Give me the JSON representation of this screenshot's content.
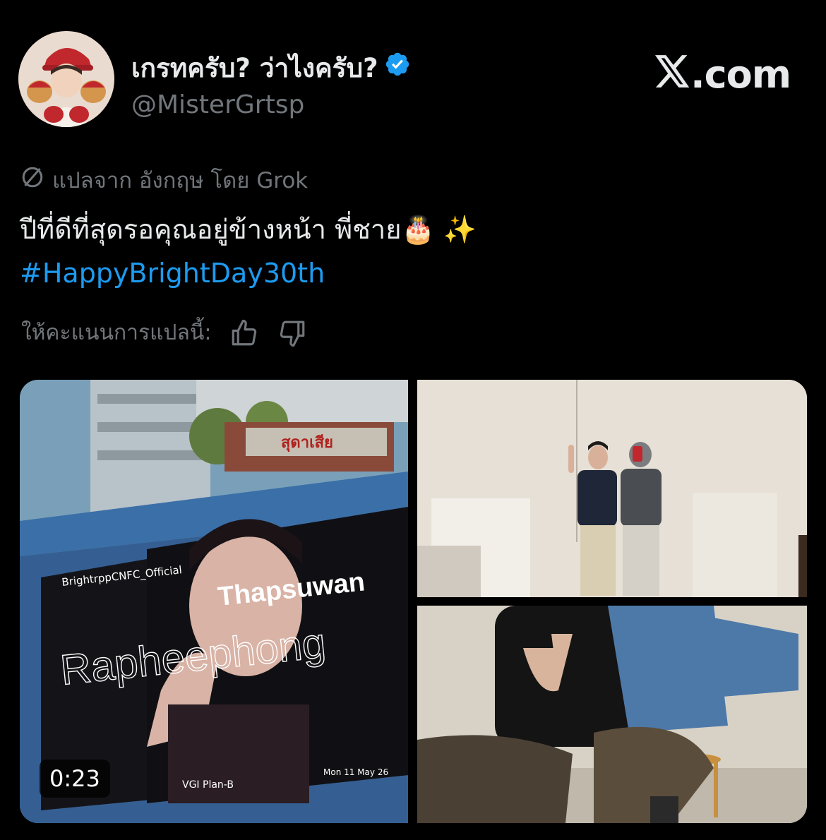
{
  "header": {
    "display_name": "เกรทครับ? ว่าไงครับ?",
    "handle": "@MisterGrtsp",
    "brand": ".com"
  },
  "translation": {
    "label": "แปลจาก อังกฤษ โดย Grok"
  },
  "tweet": {
    "text": "ปีที่ดีที่สุดรอคุณอยู่ข้างหน้า พี่ชาย🎂 ✨",
    "hashtag": "#HappyBrightDay30th"
  },
  "rating": {
    "label": "ให้คะแนนการแปลนี้:"
  },
  "media": {
    "billboard_account": "BrightrppCNFC_Official",
    "billboard_name_1": "Thapsuwan",
    "billboard_name_2": "Rapheephong",
    "billboard_sign": "สุดาเสีย",
    "billboard_footer_left": "VGI Plan-B",
    "billboard_footer_right": "Mon 11 May 26",
    "video_duration": "0:23"
  },
  "colors": {
    "background": "#000000",
    "text_primary": "#e7e9ea",
    "text_secondary": "#71767b",
    "link": "#1d9bf0",
    "verified": "#1d9bf0"
  },
  "icons": [
    "verified-badge-icon",
    "x-logo-icon",
    "translate-icon",
    "thumbs-up-icon",
    "thumbs-down-icon"
  ]
}
